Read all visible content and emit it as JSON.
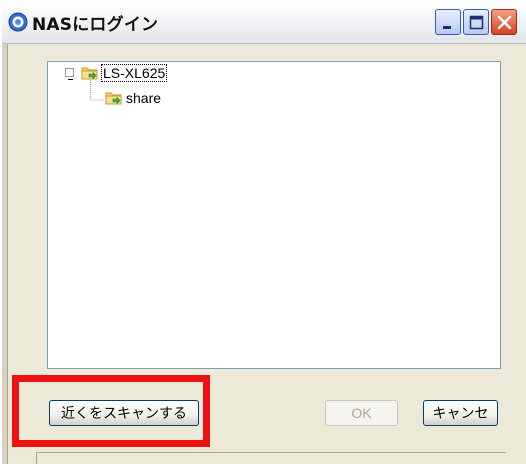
{
  "window": {
    "title": "NASにログイン",
    "controls": [
      "minimize",
      "maximize",
      "close"
    ]
  },
  "tree": {
    "items": [
      {
        "label": "LS-XL625",
        "expander": "⊟",
        "icon": "network-folder-icon",
        "selected": true
      },
      {
        "label": "share",
        "icon": "network-folder-icon",
        "selected": false
      }
    ]
  },
  "buttons": {
    "scan_label": "近くをスキャンする",
    "ok_label": "OK",
    "cancel_label": "キャンセ"
  },
  "colors": {
    "highlight": "#ee1111",
    "panel_border": "#7f9db9"
  }
}
